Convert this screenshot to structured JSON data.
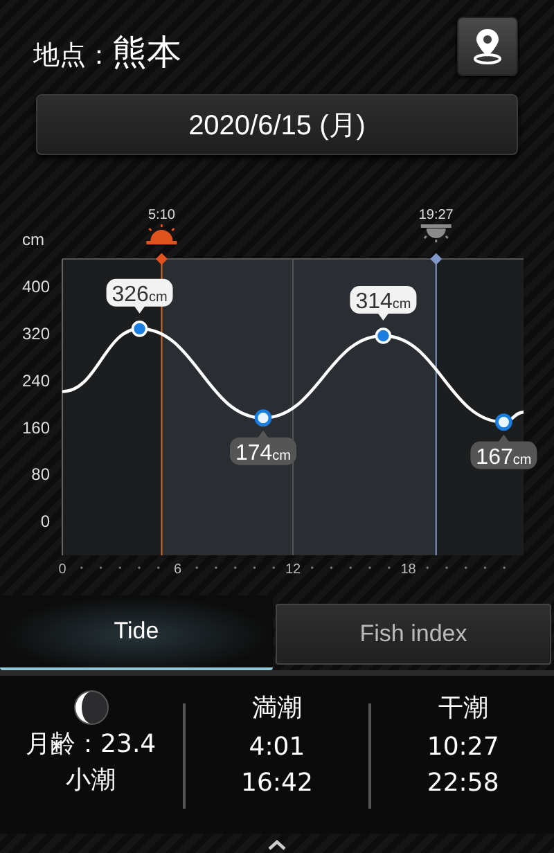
{
  "header": {
    "label": "地点：",
    "location": "熊本"
  },
  "date": "2020/6/15 (月)",
  "tide_chart": {
    "sun_markers": [
      {
        "kind": "sunrise",
        "time": "5:10"
      },
      {
        "kind": "sunset",
        "time": "19:27"
      }
    ],
    "chart_data": {
      "type": "line",
      "ylabel": "cm",
      "x": [
        0,
        4.02,
        10.45,
        16.7,
        22.97,
        24
      ],
      "series": [
        {
          "color": "#ffffff",
          "values": [
            219,
            326,
            174,
            314,
            167,
            184
          ]
        }
      ],
      "bands": [
        {
          "axis": "x",
          "from": 5.17,
          "to": 19.45,
          "color": "#2a2d31"
        }
      ],
      "ref_lines": [
        {
          "axis": "x",
          "value": 5.17,
          "color": "#d26a30"
        },
        {
          "axis": "x",
          "value": 19.45,
          "color": "#7f98c8"
        }
      ],
      "xlim": [
        0,
        24
      ],
      "ylim": [
        -60,
        445
      ],
      "xticks": [
        0,
        6,
        12,
        18
      ],
      "yticks": [
        0,
        80,
        160,
        240,
        320,
        400
      ],
      "annotations": [
        {
          "x": 4.02,
          "y": 326,
          "text": "326cm"
        },
        {
          "x": 10.45,
          "y": 174,
          "text": "174cm"
        },
        {
          "x": 16.7,
          "y": 314,
          "text": "314cm"
        },
        {
          "x": 22.97,
          "y": 167,
          "text": "167cm"
        }
      ]
    }
  },
  "tabs": [
    {
      "label": "Tide",
      "selected": true
    },
    {
      "label": "Fish index",
      "selected": false
    }
  ],
  "moon": {
    "age": "月齢：23.4",
    "tide_name": "小潮"
  },
  "tide_columns": [
    {
      "title": "満潮",
      "times": [
        "4:01",
        "16:42"
      ]
    },
    {
      "title": "干潮",
      "times": [
        "10:27",
        "22:58"
      ]
    }
  ]
}
